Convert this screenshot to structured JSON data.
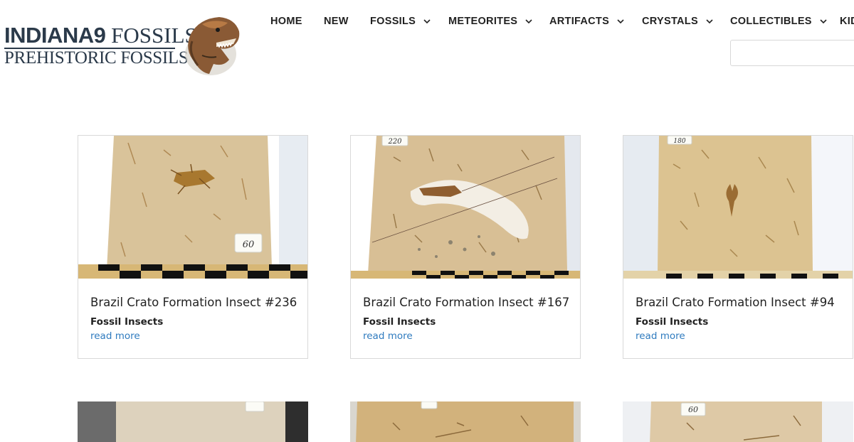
{
  "site": {
    "logo_line1_bold": "INDIANA9",
    "logo_line1_thin": " FOSSILS",
    "logo_line2": "PREHISTORIC FOSSILS",
    "logo_icon": "t-rex-head-icon"
  },
  "nav": {
    "items": [
      {
        "label": "HOME",
        "has_dropdown": false
      },
      {
        "label": "NEW",
        "has_dropdown": false
      },
      {
        "label": "FOSSILS",
        "has_dropdown": true
      },
      {
        "label": "METEORITES",
        "has_dropdown": true
      },
      {
        "label": "ARTIFACTS",
        "has_dropdown": true
      },
      {
        "label": "CRYSTALS",
        "has_dropdown": true
      },
      {
        "label": "COLLECTIBLES",
        "has_dropdown": true
      },
      {
        "label": "KID",
        "has_dropdown": false
      }
    ]
  },
  "search": {
    "placeholder": ""
  },
  "products": [
    {
      "title": "Brazil Crato Formation Insect #236",
      "category": "Fossil Insects",
      "link": "read more",
      "price_tag": "60"
    },
    {
      "title": "Brazil Crato Formation Insect #167",
      "category": "Fossil Insects",
      "link": "read more",
      "price_tag": "220"
    },
    {
      "title": "Brazil Crato Formation Insect #94",
      "category": "Fossil Insects",
      "link": "read more",
      "price_tag": "180"
    }
  ],
  "second_row_tags": [
    "",
    "",
    "60"
  ],
  "colors": {
    "link": "#2f7bbf",
    "text": "#222222",
    "stone": "#d9c39a",
    "border": "#d9d9d9"
  }
}
